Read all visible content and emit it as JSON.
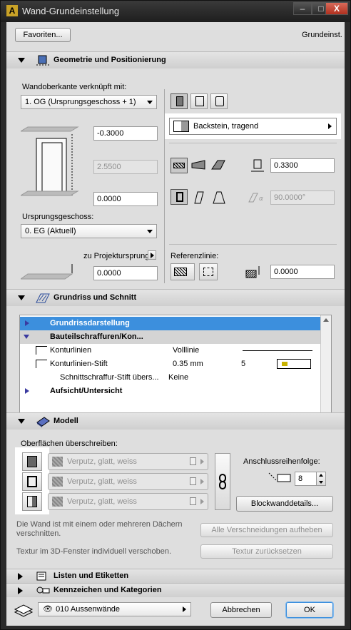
{
  "window": {
    "title": "Wand-Grundeinstellung",
    "min": "–",
    "max": "□",
    "close": "X"
  },
  "top": {
    "favorites": "Favoriten...",
    "preset": "Grundeinst."
  },
  "geometry": {
    "title": "Geometrie und Positionierung",
    "top_link_label": "Wandoberkante verknüpft mit:",
    "top_link_value": "1. OG (Ursprungsgeschoss + 1)",
    "top_offset": "-0.3000",
    "height": "2.5500",
    "base_offset": "0.0000",
    "home_story_label": "Ursprungsgeschoss:",
    "home_story_value": "0. EG (Aktuell)",
    "to_project_zero": "zu Projektursprung",
    "project_zero_value": "0.0000",
    "material": "Backstein, tragend",
    "thickness": "0.3300",
    "slant_angle": "90.0000°",
    "ref_line_label": "Referenzlinie:",
    "ref_offset": "0.0000"
  },
  "floorplan": {
    "title": "Grundriss und Schnitt",
    "rows": [
      {
        "label": "Grundrissdarstellung"
      },
      {
        "label": "Bauteilschraffuren/Kon..."
      },
      {
        "label": "Konturlinien",
        "value": "Volllinie"
      },
      {
        "label": "Konturlinien-Stift",
        "value": "0.35 mm",
        "pen": "5"
      },
      {
        "label": "Schnittschraffur-Stift übers...",
        "value": "Keine"
      },
      {
        "label": "Aufsicht/Untersicht"
      }
    ]
  },
  "model": {
    "title": "Modell",
    "override_label": "Oberflächen überschreiben:",
    "surfaces": [
      "Verputz, glatt, weiss",
      "Verputz, glatt, weiss",
      "Verputz, glatt, weiss"
    ],
    "junction_label": "Anschlussreihenfolge:",
    "junction_value": "8",
    "block_details": "Blockwanddetails...",
    "trim_note": "Die Wand ist mit einem oder mehreren Dächern verschnitten.",
    "trim_btn": "Alle Verschneidungen aufheben",
    "texture_note": "Textur im 3D-Fenster individuell verschoben.",
    "texture_btn": "Textur zurücksetzen"
  },
  "collapsed": {
    "lists": "Listen und Etiketten",
    "ids": "Kennzeichen und Kategorien"
  },
  "footer": {
    "layer": "010 Aussenwände",
    "cancel": "Abbrechen",
    "ok": "OK"
  },
  "colors": {
    "accent": "#3c8fdd",
    "pen_yellow": "#c9b300",
    "highlight": "#ffffff",
    "window_bg": "#dedede"
  }
}
